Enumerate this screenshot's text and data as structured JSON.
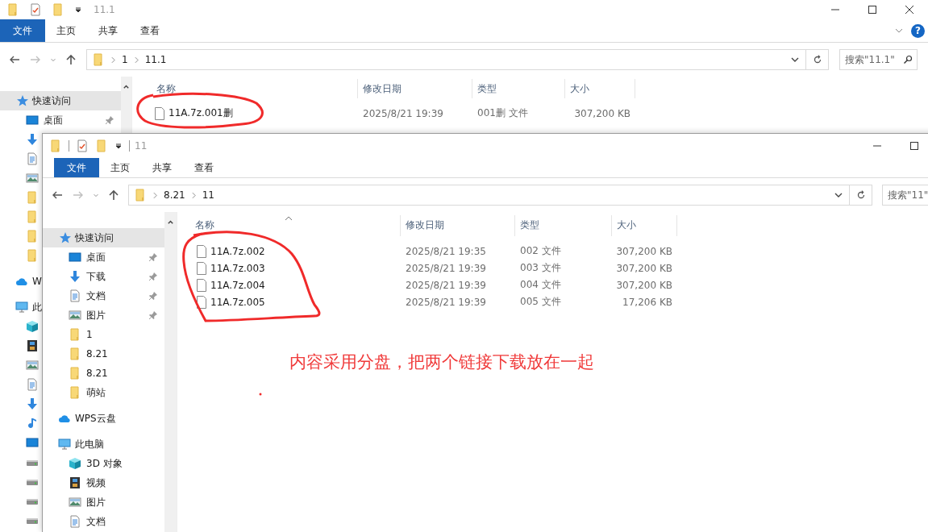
{
  "back_window": {
    "title": "11.1",
    "ribbon_tabs": [
      {
        "label": "文件",
        "selected": true
      },
      {
        "label": "主页",
        "selected": false
      },
      {
        "label": "共享",
        "selected": false
      },
      {
        "label": "查看",
        "selected": false
      }
    ],
    "help": "?",
    "path": [
      "1",
      "11.1"
    ],
    "search": {
      "placeholder": "搜索\"11.1\""
    },
    "sidebar": [
      {
        "kind": "star",
        "label": "快速访问",
        "selected": true,
        "children": [
          {
            "kind": "desktop",
            "label": "桌面",
            "pinned": true
          },
          {
            "kind": "download"
          },
          {
            "kind": "document"
          },
          {
            "kind": "pictures"
          },
          {
            "kind": "folder"
          },
          {
            "kind": "folder"
          },
          {
            "kind": "folder"
          },
          {
            "kind": "folder"
          }
        ]
      },
      {
        "kind": "cloud",
        "label": "W",
        "selected": false
      },
      {
        "kind": "computer",
        "label": "此",
        "selected": false,
        "children": [
          {
            "kind": "cube"
          },
          {
            "kind": "video"
          },
          {
            "kind": "pictures"
          },
          {
            "kind": "document"
          },
          {
            "kind": "download"
          },
          {
            "kind": "music"
          },
          {
            "kind": "desktop"
          },
          {
            "kind": "drive"
          },
          {
            "kind": "drive"
          },
          {
            "kind": "drive"
          },
          {
            "kind": "drive"
          }
        ]
      }
    ],
    "columns": [
      {
        "label": "名称"
      },
      {
        "label": "修改日期"
      },
      {
        "label": "类型"
      },
      {
        "label": "大小"
      }
    ],
    "files": [
      {
        "name": "11A.7z.001删",
        "modified": "2025/8/21 19:39",
        "type": "001删 文件",
        "size": "307,200 KB"
      }
    ]
  },
  "front_window": {
    "title": "11",
    "ribbon_tabs": [
      {
        "label": "文件",
        "selected": true
      },
      {
        "label": "主页",
        "selected": false
      },
      {
        "label": "共享",
        "selected": false
      },
      {
        "label": "查看",
        "selected": false
      }
    ],
    "path": [
      "8.21",
      "11"
    ],
    "search": {
      "placeholder": "搜索\"11\""
    },
    "sidebar": [
      {
        "kind": "star",
        "label": "快速访问",
        "selected": true,
        "children": [
          {
            "kind": "desktop",
            "label": "桌面",
            "pinned": true
          },
          {
            "kind": "download",
            "label": "下载",
            "pinned": true
          },
          {
            "kind": "document",
            "label": "文档",
            "pinned": true
          },
          {
            "kind": "pictures",
            "label": "图片",
            "pinned": true
          },
          {
            "kind": "folder",
            "label": "1",
            "pinned": false
          },
          {
            "kind": "folder",
            "label": "8.21",
            "pinned": false
          },
          {
            "kind": "folder",
            "label": "8.21",
            "pinned": false
          },
          {
            "kind": "folder",
            "label": "萌站",
            "pinned": false
          }
        ]
      },
      {
        "kind": "cloud",
        "label": "WPS云盘",
        "selected": false
      },
      {
        "kind": "computer",
        "label": "此电脑",
        "selected": false,
        "children": [
          {
            "kind": "cube",
            "label": "3D 对象",
            "pinned": false
          },
          {
            "kind": "video",
            "label": "视频",
            "pinned": false
          },
          {
            "kind": "pictures",
            "label": "图片",
            "pinned": false
          },
          {
            "kind": "document",
            "label": "文档",
            "pinned": false
          }
        ]
      }
    ],
    "columns": [
      {
        "label": "名称",
        "sorted": true
      },
      {
        "label": "修改日期",
        "sorted": false
      },
      {
        "label": "类型",
        "sorted": false
      },
      {
        "label": "大小",
        "sorted": false
      }
    ],
    "files": [
      {
        "name": "11A.7z.002",
        "modified": "2025/8/21 19:35",
        "type": "002 文件",
        "size": "307,200 KB"
      },
      {
        "name": "11A.7z.003",
        "modified": "2025/8/21 19:39",
        "type": "003 文件",
        "size": "307,200 KB"
      },
      {
        "name": "11A.7z.004",
        "modified": "2025/8/21 19:39",
        "type": "004 文件",
        "size": "307,200 KB"
      },
      {
        "name": "11A.7z.005",
        "modified": "2025/8/21 19:39",
        "type": "005 文件",
        "size": "17,206 KB"
      }
    ],
    "note": "内容采用分盘，把两个链接下载放在一起"
  }
}
